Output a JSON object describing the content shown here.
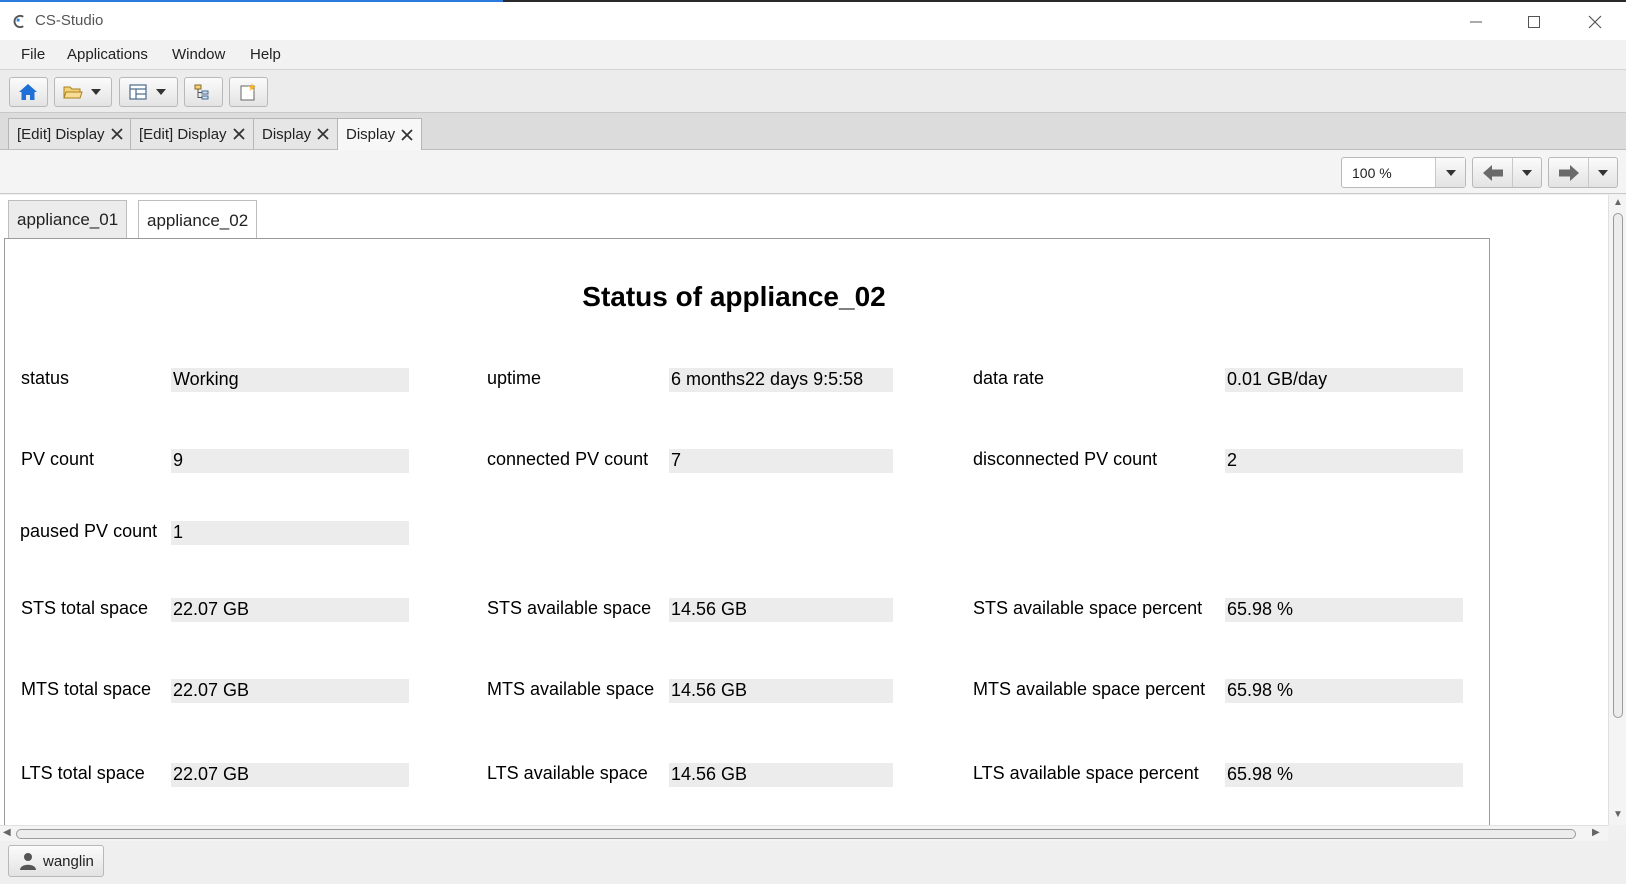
{
  "window": {
    "title": "CS-Studio"
  },
  "menubar": {
    "items": [
      "File",
      "Applications",
      "Window",
      "Help"
    ]
  },
  "toolbar": {
    "buttons": [
      {
        "icon": "home-icon"
      },
      {
        "icon": "open-folder-icon"
      },
      {
        "icon": "layout-icon"
      },
      {
        "icon": "tree-icon"
      },
      {
        "icon": "new-note-icon"
      }
    ]
  },
  "doc_tabs": [
    {
      "label": "[Edit] Display",
      "active": false
    },
    {
      "label": "[Edit] Display",
      "active": false
    },
    {
      "label": "Display",
      "active": false
    },
    {
      "label": "Display",
      "active": true
    }
  ],
  "display_toolbar": {
    "zoom": "100 %"
  },
  "panel_tabs": [
    {
      "label": "appliance_01",
      "active": false
    },
    {
      "label": "appliance_02",
      "active": true
    }
  ],
  "panel": {
    "title": "Status of appliance_02",
    "rows": [
      [
        {
          "label": "status",
          "value": "Working"
        },
        {
          "label": "uptime",
          "value": "6 months22 days 9:5:58"
        },
        {
          "label": "data rate",
          "value": "0.01 GB/day"
        }
      ],
      [
        {
          "label": "PV count",
          "value": "9"
        },
        {
          "label": "connected PV count",
          "value": "7"
        },
        {
          "label": "disconnected PV count",
          "value": "2"
        }
      ],
      [
        {
          "label": "paused PV count",
          "value": "1"
        }
      ],
      [
        {
          "label": "STS total space",
          "value": "22.07 GB"
        },
        {
          "label": "STS available space",
          "value": "14.56 GB"
        },
        {
          "label": "STS available space percent",
          "value": "65.98 %"
        }
      ],
      [
        {
          "label": "MTS total space",
          "value": "22.07 GB"
        },
        {
          "label": "MTS available space",
          "value": "14.56 GB"
        },
        {
          "label": "MTS available space percent",
          "value": "65.98 %"
        }
      ],
      [
        {
          "label": "LTS total space",
          "value": "22.07 GB"
        },
        {
          "label": "LTS available space",
          "value": "14.56 GB"
        },
        {
          "label": "LTS available space percent",
          "value": "65.98 %"
        }
      ]
    ]
  },
  "statusbar": {
    "user": "wanglin"
  },
  "colors": {
    "accent": "#2a7be0",
    "home_icon": "#1f6fd6",
    "field_bg": "#ececec"
  }
}
